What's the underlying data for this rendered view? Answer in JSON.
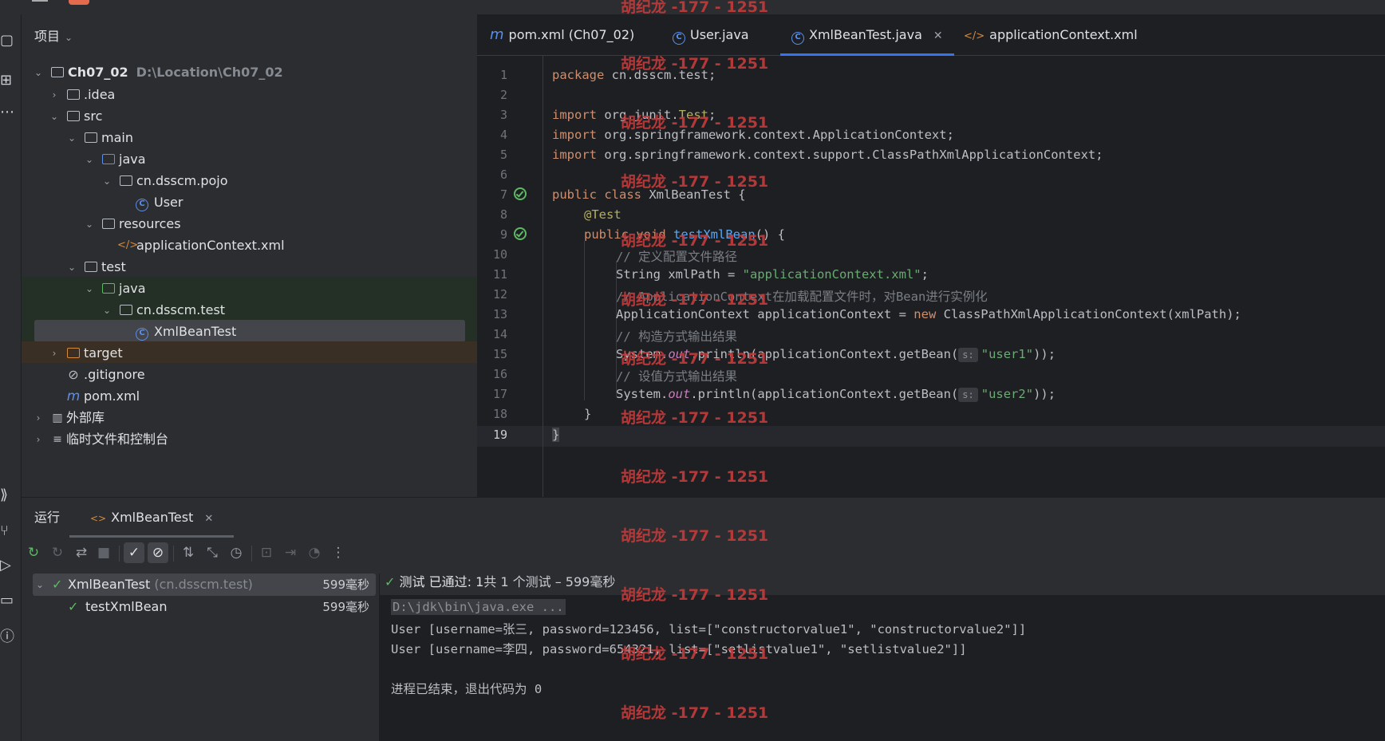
{
  "project_panel": {
    "title": "项目",
    "tree": [
      {
        "label": "Ch07_02",
        "path": "D:\\Location\\Ch07_02"
      },
      {
        "label": ".idea"
      },
      {
        "label": "src"
      },
      {
        "label": "main"
      },
      {
        "label": "java"
      },
      {
        "label": "cn.dsscm.pojo"
      },
      {
        "label": "User"
      },
      {
        "label": "resources"
      },
      {
        "label": "applicationContext.xml"
      },
      {
        "label": "test"
      },
      {
        "label": "java"
      },
      {
        "label": "cn.dsscm.test"
      },
      {
        "label": "XmlBeanTest"
      },
      {
        "label": "target"
      },
      {
        "label": ".gitignore"
      },
      {
        "label": "pom.xml"
      },
      {
        "label": "外部库"
      },
      {
        "label": "临时文件和控制台"
      }
    ]
  },
  "editor": {
    "tabs": [
      {
        "label": "pom.xml (Ch07_02)",
        "icon": "m"
      },
      {
        "label": "User.java",
        "icon": "C"
      },
      {
        "label": "XmlBeanTest.java",
        "icon": "C",
        "active": true
      },
      {
        "label": "applicationContext.xml",
        "icon": "</>"
      }
    ],
    "line_numbers": [
      "1",
      "2",
      "3",
      "4",
      "5",
      "6",
      "7",
      "8",
      "9",
      "10",
      "11",
      "12",
      "13",
      "14",
      "15",
      "16",
      "17",
      "18",
      "19"
    ],
    "code": {
      "l1_kw": "package",
      "l1_rest": " cn.dsscm.test;",
      "l3_kw": "import",
      "l3_rest": " org.junit.",
      "l3_ann": "Test",
      "l3_end": ";",
      "l4_kw": "import",
      "l4_rest": " org.springframework.context.ApplicationContext;",
      "l5_kw": "import",
      "l5_rest": " org.springframework.context.support.ClassPathXmlApplicationContext;",
      "l7_kw": "public class",
      "l7_rest": " XmlBeanTest {",
      "l8_ann": "@Test",
      "l9_kw": "public void",
      "l9_fn": "testXmlBean",
      "l9_rest": "() {",
      "l10_cmt": "// 定义配置文件路径",
      "l11_a": "String xmlPath = ",
      "l11_str": "\"applicationContext.xml\"",
      "l11_end": ";",
      "l12_cmt": "// ApplicationContext在加载配置文件时，对Bean进行实例化",
      "l13_a": "ApplicationContext applicationContext = ",
      "l13_kw": "new",
      "l13_b": " ClassPathXmlApplicationContext(xmlPath);",
      "l14_cmt": "// 构造方式输出结果",
      "l15_a": "System.",
      "l15_out": "out",
      "l15_b": ".println(applicationContext.getBean(",
      "l15_hint": "s:",
      "l15_str": "\"user1\"",
      "l15_end": "));",
      "l16_cmt": "// 设值方式输出结果",
      "l17_a": "System.",
      "l17_out": "out",
      "l17_b": ".println(applicationContext.getBean(",
      "l17_hint": "s:",
      "l17_str": "\"user2\"",
      "l17_end": "));",
      "l18": "}",
      "l19": "}"
    }
  },
  "watermark": "胡纪龙 -177 - 1251",
  "run_panel": {
    "tab_run": "运行",
    "tab_config": "XmlBeanTest",
    "tree": [
      {
        "name": "XmlBeanTest",
        "pkg": "(cn.dsscm.test)",
        "time": "599毫秒"
      },
      {
        "name": "testXmlBean",
        "time": "599毫秒"
      }
    ],
    "status_prefix": "测试 已通过: ",
    "status_count": "1",
    "status_rest": "共 1 个测试 – 599毫秒",
    "console": {
      "cmd": "D:\\jdk\\bin\\java.exe ...",
      "out1": "User [username=张三, password=123456, list=[\"constructorvalue1\", \"constructorvalue2\"]]",
      "out2": "User [username=李四, password=654321, list=[\"setlistvalue1\", \"setlistvalue2\"]]",
      "exit": "进程已结束，退出代码为 0"
    }
  },
  "colors": {
    "accent": "#3574f0",
    "pass": "#5fb865",
    "watermark": "#c23b3b"
  }
}
